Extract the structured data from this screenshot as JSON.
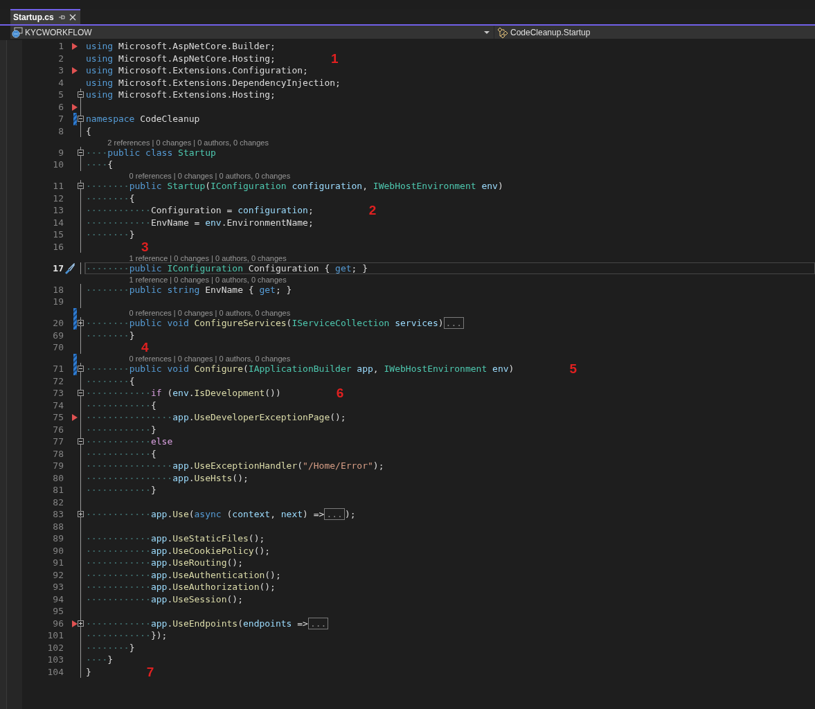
{
  "tabs": [
    {
      "label": "Startup.cs",
      "selected": true
    }
  ],
  "nav": {
    "project": "KYCWORKFLOW",
    "member": "CodeCleanup.Startup"
  },
  "lines": [
    {
      "number": "1",
      "marker": true,
      "changed": false,
      "current": false,
      "tokens": [
        {
          "kind": "kw",
          "text": "using"
        },
        {
          "kind": "plain",
          "text": " Microsoft.AspNetCore.Builder;"
        }
      ]
    },
    {
      "number": "2",
      "marker": false,
      "changed": false,
      "current": false,
      "tokens": [
        {
          "kind": "kw",
          "text": "using"
        },
        {
          "kind": "plain",
          "text": " Microsoft.AspNetCore.Hosting;"
        }
      ],
      "annotation": "1"
    },
    {
      "number": "3",
      "marker": true,
      "changed": false,
      "current": false,
      "tokens": [
        {
          "kind": "kw",
          "text": "using"
        },
        {
          "kind": "plain",
          "text": " Microsoft.Extensions.Configuration;"
        }
      ]
    },
    {
      "number": "4",
      "marker": false,
      "changed": false,
      "current": false,
      "tokens": [
        {
          "kind": "kw",
          "text": "using"
        },
        {
          "kind": "plain",
          "text": " Microsoft.Extensions.DependencyInjection;"
        }
      ]
    },
    {
      "number": "5",
      "marker": false,
      "changed": false,
      "current": false,
      "expanded": true,
      "tokens": [
        {
          "kind": "kw",
          "text": "using"
        },
        {
          "kind": "plain",
          "text": " Microsoft.Extensions.Hosting;"
        }
      ]
    },
    {
      "number": "6",
      "marker": true,
      "changed": false,
      "current": false
    },
    {
      "number": "7",
      "marker": false,
      "changed": true,
      "current": false,
      "expanded": true,
      "tokens": [
        {
          "kind": "kw",
          "text": "namespace"
        },
        {
          "kind": "plain",
          "text": " CodeCleanup"
        }
      ]
    },
    {
      "number": "8",
      "marker": false,
      "changed": false,
      "current": false,
      "tokens": [
        {
          "kind": "plain",
          "text": "{"
        }
      ]
    },
    {
      "number": "9",
      "marker": false,
      "changed": false,
      "current": false,
      "expanded": true,
      "lens": "2 references | 0 changes | 0 authors, 0 changes",
      "tokens": [
        {
          "kind": "kw",
          "text": "    public class"
        },
        {
          "kind": "type",
          "text": " Startup"
        }
      ]
    },
    {
      "number": "10",
      "marker": false,
      "changed": false,
      "current": false,
      "tokens": [
        {
          "kind": "plain",
          "text": "    {"
        }
      ]
    },
    {
      "number": "11",
      "marker": false,
      "changed": false,
      "current": false,
      "expanded": true,
      "lens": "0 references | 0 changes | 0 authors, 0 changes",
      "tokens": [
        {
          "kind": "kw",
          "text": "        public"
        },
        {
          "kind": "type",
          "text": " Startup"
        },
        {
          "kind": "plain",
          "text": "("
        },
        {
          "kind": "type",
          "text": "IConfiguration"
        },
        {
          "kind": "var",
          "text": " configuration"
        },
        {
          "kind": "plain",
          "text": ", "
        },
        {
          "kind": "type",
          "text": "IWebHostEnvironment"
        },
        {
          "kind": "var",
          "text": " env"
        },
        {
          "kind": "plain",
          "text": ")"
        }
      ]
    },
    {
      "number": "12",
      "marker": false,
      "changed": false,
      "current": false,
      "tokens": [
        {
          "kind": "plain",
          "text": "        {"
        }
      ]
    },
    {
      "number": "13",
      "marker": false,
      "changed": false,
      "current": false,
      "tokens": [
        {
          "kind": "plain",
          "text": "            Configuration = "
        },
        {
          "kind": "var",
          "text": "configuration"
        },
        {
          "kind": "plain",
          "text": ";"
        }
      ],
      "annotation": "2"
    },
    {
      "number": "14",
      "marker": false,
      "changed": false,
      "current": false,
      "tokens": [
        {
          "kind": "plain",
          "text": "            EnvName = "
        },
        {
          "kind": "var",
          "text": "env"
        },
        {
          "kind": "plain",
          "text": ".EnvironmentName;"
        }
      ]
    },
    {
      "number": "15",
      "marker": false,
      "changed": false,
      "current": false,
      "tokens": [
        {
          "kind": "plain",
          "text": "        }"
        }
      ]
    },
    {
      "number": "16",
      "marker": false,
      "changed": false,
      "current": false,
      "annotation": "3"
    },
    {
      "number": "17",
      "marker": false,
      "changed": false,
      "current": true,
      "lens": "1 reference | 0 changes | 0 authors, 0 changes",
      "tokens": [
        {
          "kind": "kw",
          "text": "        public"
        },
        {
          "kind": "type",
          "text": " IConfiguration"
        },
        {
          "kind": "plain",
          "text": " Configuration { "
        },
        {
          "kind": "kw",
          "text": "get"
        },
        {
          "kind": "plain",
          "text": "; }"
        }
      ]
    },
    {
      "number": "18",
      "marker": false,
      "changed": false,
      "current": false,
      "lens": "1 reference | 0 changes | 0 authors, 0 changes",
      "tokens": [
        {
          "kind": "kw",
          "text": "        public string"
        },
        {
          "kind": "plain",
          "text": " EnvName { "
        },
        {
          "kind": "kw",
          "text": "get"
        },
        {
          "kind": "plain",
          "text": "; }"
        }
      ]
    },
    {
      "number": "19",
      "marker": false,
      "changed": false,
      "current": false
    },
    {
      "number": "20",
      "marker": false,
      "changed": true,
      "current": false,
      "expanded": false,
      "lens": "0 references | 0 changes | 0 authors, 0 changes",
      "tokens": [
        {
          "kind": "kw",
          "text": "        public void"
        },
        {
          "kind": "method",
          "text": " ConfigureServices"
        },
        {
          "kind": "plain",
          "text": "("
        },
        {
          "kind": "type",
          "text": "IServiceCollection"
        },
        {
          "kind": "var",
          "text": " services"
        },
        {
          "kind": "plain",
          "text": ")"
        },
        {
          "kind": "collapsed",
          "text": "..."
        }
      ]
    },
    {
      "number": "69",
      "marker": false,
      "changed": false,
      "current": false,
      "tokens": [
        {
          "kind": "plain",
          "text": "        }"
        }
      ]
    },
    {
      "number": "70",
      "marker": false,
      "changed": false,
      "current": false,
      "annotation": "4"
    },
    {
      "number": "71",
      "marker": false,
      "changed": true,
      "current": false,
      "expanded": true,
      "lens": "0 references | 0 changes | 0 authors, 0 changes",
      "tokens": [
        {
          "kind": "kw",
          "text": "        public void"
        },
        {
          "kind": "method",
          "text": " Configure"
        },
        {
          "kind": "plain",
          "text": "("
        },
        {
          "kind": "type",
          "text": "IApplicationBuilder"
        },
        {
          "kind": "var",
          "text": " app"
        },
        {
          "kind": "plain",
          "text": ", "
        },
        {
          "kind": "type",
          "text": "IWebHostEnvironment"
        },
        {
          "kind": "var",
          "text": " env"
        },
        {
          "kind": "plain",
          "text": ")"
        }
      ],
      "annotation": "5"
    },
    {
      "number": "72",
      "marker": false,
      "changed": false,
      "current": false,
      "tokens": [
        {
          "kind": "plain",
          "text": "        {"
        }
      ]
    },
    {
      "number": "73",
      "marker": false,
      "changed": false,
      "current": false,
      "expanded": true,
      "tokens": [
        {
          "kind": "ctrl",
          "text": "            if"
        },
        {
          "kind": "plain",
          "text": " ("
        },
        {
          "kind": "var",
          "text": "env"
        },
        {
          "kind": "plain",
          "text": "."
        },
        {
          "kind": "method",
          "text": "IsDevelopment"
        },
        {
          "kind": "plain",
          "text": "())"
        }
      ],
      "annotation": "6"
    },
    {
      "number": "74",
      "marker": false,
      "changed": false,
      "current": false,
      "tokens": [
        {
          "kind": "plain",
          "text": "            {"
        }
      ]
    },
    {
      "number": "75",
      "marker": true,
      "changed": false,
      "current": false,
      "tokens": [
        {
          "kind": "var",
          "text": "                app"
        },
        {
          "kind": "plain",
          "text": "."
        },
        {
          "kind": "method",
          "text": "UseDeveloperExceptionPage"
        },
        {
          "kind": "plain",
          "text": "();"
        }
      ]
    },
    {
      "number": "76",
      "marker": false,
      "changed": false,
      "current": false,
      "tokens": [
        {
          "kind": "plain",
          "text": "            }"
        }
      ]
    },
    {
      "number": "77",
      "marker": false,
      "changed": false,
      "current": false,
      "expanded": true,
      "tokens": [
        {
          "kind": "ctrl",
          "text": "            else"
        }
      ]
    },
    {
      "number": "78",
      "marker": false,
      "changed": false,
      "current": false,
      "tokens": [
        {
          "kind": "plain",
          "text": "            {"
        }
      ]
    },
    {
      "number": "79",
      "marker": false,
      "changed": false,
      "current": false,
      "tokens": [
        {
          "kind": "var",
          "text": "                app"
        },
        {
          "kind": "plain",
          "text": "."
        },
        {
          "kind": "method",
          "text": "UseExceptionHandler"
        },
        {
          "kind": "plain",
          "text": "("
        },
        {
          "kind": "str",
          "text": "\"/Home/Error\""
        },
        {
          "kind": "plain",
          "text": ");"
        }
      ]
    },
    {
      "number": "80",
      "marker": false,
      "changed": false,
      "current": false,
      "tokens": [
        {
          "kind": "var",
          "text": "                app"
        },
        {
          "kind": "plain",
          "text": "."
        },
        {
          "kind": "method",
          "text": "UseHsts"
        },
        {
          "kind": "plain",
          "text": "();"
        }
      ]
    },
    {
      "number": "81",
      "marker": false,
      "changed": false,
      "current": false,
      "tokens": [
        {
          "kind": "plain",
          "text": "            }"
        }
      ]
    },
    {
      "number": "82",
      "marker": false,
      "changed": false,
      "current": false
    },
    {
      "number": "83",
      "marker": false,
      "changed": false,
      "current": false,
      "expanded": false,
      "tokens": [
        {
          "kind": "var",
          "text": "            app"
        },
        {
          "kind": "plain",
          "text": "."
        },
        {
          "kind": "method",
          "text": "Use"
        },
        {
          "kind": "plain",
          "text": "("
        },
        {
          "kind": "kw",
          "text": "async"
        },
        {
          "kind": "plain",
          "text": " ("
        },
        {
          "kind": "var",
          "text": "context"
        },
        {
          "kind": "plain",
          "text": ", "
        },
        {
          "kind": "var",
          "text": "next"
        },
        {
          "kind": "plain",
          "text": ") =>"
        },
        {
          "kind": "collapsed",
          "text": "..."
        },
        {
          "kind": "plain",
          "text": ");"
        }
      ]
    },
    {
      "number": "88",
      "marker": false,
      "changed": false,
      "current": false
    },
    {
      "number": "89",
      "marker": false,
      "changed": false,
      "current": false,
      "tokens": [
        {
          "kind": "var",
          "text": "            app"
        },
        {
          "kind": "plain",
          "text": "."
        },
        {
          "kind": "method",
          "text": "UseStaticFiles"
        },
        {
          "kind": "plain",
          "text": "();"
        }
      ]
    },
    {
      "number": "90",
      "marker": false,
      "changed": false,
      "current": false,
      "tokens": [
        {
          "kind": "var",
          "text": "            app"
        },
        {
          "kind": "plain",
          "text": "."
        },
        {
          "kind": "method",
          "text": "UseCookiePolicy"
        },
        {
          "kind": "plain",
          "text": "();"
        }
      ]
    },
    {
      "number": "91",
      "marker": false,
      "changed": false,
      "current": false,
      "tokens": [
        {
          "kind": "var",
          "text": "            app"
        },
        {
          "kind": "plain",
          "text": "."
        },
        {
          "kind": "method",
          "text": "UseRouting"
        },
        {
          "kind": "plain",
          "text": "();"
        }
      ]
    },
    {
      "number": "92",
      "marker": false,
      "changed": false,
      "current": false,
      "tokens": [
        {
          "kind": "var",
          "text": "            app"
        },
        {
          "kind": "plain",
          "text": "."
        },
        {
          "kind": "method",
          "text": "UseAuthentication"
        },
        {
          "kind": "plain",
          "text": "();"
        }
      ]
    },
    {
      "number": "93",
      "marker": false,
      "changed": false,
      "current": false,
      "tokens": [
        {
          "kind": "var",
          "text": "            app"
        },
        {
          "kind": "plain",
          "text": "."
        },
        {
          "kind": "method",
          "text": "UseAuthorization"
        },
        {
          "kind": "plain",
          "text": "();"
        }
      ]
    },
    {
      "number": "94",
      "marker": false,
      "changed": false,
      "current": false,
      "tokens": [
        {
          "kind": "var",
          "text": "            app"
        },
        {
          "kind": "plain",
          "text": "."
        },
        {
          "kind": "method",
          "text": "UseSession"
        },
        {
          "kind": "plain",
          "text": "();"
        }
      ]
    },
    {
      "number": "95",
      "marker": false,
      "changed": false,
      "current": false
    },
    {
      "number": "96",
      "marker": true,
      "changed": false,
      "current": false,
      "expanded": false,
      "tokens": [
        {
          "kind": "var",
          "text": "            app"
        },
        {
          "kind": "plain",
          "text": "."
        },
        {
          "kind": "method",
          "text": "UseEndpoints"
        },
        {
          "kind": "plain",
          "text": "("
        },
        {
          "kind": "var",
          "text": "endpoints"
        },
        {
          "kind": "plain",
          "text": " =>"
        },
        {
          "kind": "collapsed",
          "text": "..."
        }
      ]
    },
    {
      "number": "101",
      "marker": false,
      "changed": false,
      "current": false,
      "tokens": [
        {
          "kind": "plain",
          "text": "            });"
        }
      ]
    },
    {
      "number": "102",
      "marker": false,
      "changed": false,
      "current": false,
      "tokens": [
        {
          "kind": "plain",
          "text": "        }"
        }
      ]
    },
    {
      "number": "103",
      "marker": false,
      "changed": false,
      "current": false,
      "tokens": [
        {
          "kind": "plain",
          "text": "    }"
        }
      ]
    },
    {
      "number": "104",
      "marker": false,
      "changed": false,
      "current": false,
      "tokens": [
        {
          "kind": "plain",
          "text": "}"
        }
      ],
      "annotation": "7"
    }
  ]
}
